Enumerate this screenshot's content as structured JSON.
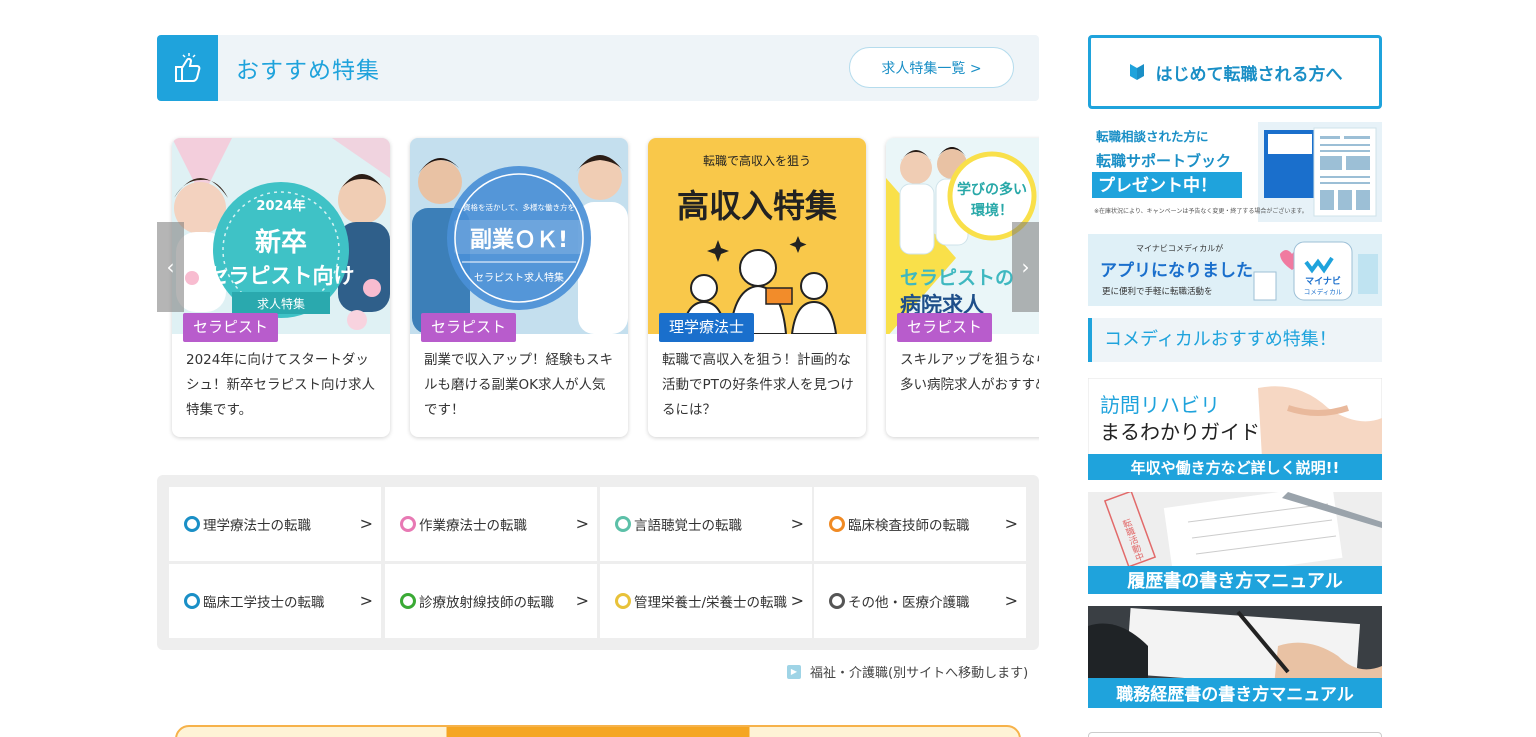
{
  "section": {
    "title": "おすすめ特集",
    "list_button": "求人特集一覧 >"
  },
  "cards": [
    {
      "image_title_lines": [
        "2024年",
        "新卒",
        "セラピスト向け",
        "求人特集"
      ],
      "tag": "セラピスト",
      "tag_color": "#b85ccc",
      "text": "2024年に向けてスタートダッシュ！新卒セラピスト向け求人特集です。"
    },
    {
      "image_title_lines": [
        "資格を活かして、多様な働き方を",
        "副業ＯＫ!",
        "セラピスト求人特集"
      ],
      "tag": "セラピスト",
      "tag_color": "#b85ccc",
      "text": "副業で収入アップ！経験もスキルも磨ける副業OK求人が人気です！"
    },
    {
      "image_title_lines": [
        "転職で高収入を狙う",
        "高収入特集"
      ],
      "tag": "理学療法士",
      "tag_color": "#1a6fcc",
      "text": "転職で高収入を狙う！計画的な活動でPTの好条件求人を見つけるには？"
    },
    {
      "image_title_lines": [
        "学びの多い",
        "環境！",
        "セラピストの",
        "病院求人"
      ],
      "tag": "セラピスト",
      "tag_color": "#b85ccc",
      "text": "スキルアップを狙うなら学びの多い病院求人がおすすめです！"
    }
  ],
  "carousel": {
    "prev": "‹",
    "next": "›"
  },
  "jobs": [
    {
      "label": "理学療法士の転職",
      "color": "#1a8fc6"
    },
    {
      "label": "作業療法士の転職",
      "color": "#e879b4"
    },
    {
      "label": "言語聴覚士の転職",
      "color": "#5cc0a8"
    },
    {
      "label": "臨床検査技師の転職",
      "color": "#f08a24"
    },
    {
      "label": "臨床工学技士の転職",
      "color": "#1a8fc6"
    },
    {
      "label": "診療放射線技師の転職",
      "color": "#3aaa35"
    },
    {
      "label": "管理栄養士/栄養士の転職",
      "color": "#e8c23a"
    },
    {
      "label": "その他・医療介護職",
      "color": "#555555"
    }
  ],
  "external_link": "福祉・介護職(別サイトへ移動します)",
  "sidebar": {
    "first_time": "はじめて転職される方へ",
    "book": {
      "line1": "転職相談された方に",
      "line2": "転職サポートブック",
      "line3": "プレゼント中！",
      "note": "※在庫状況により、キャンペーンは予告なく変更・終了する場合がございます。"
    },
    "app": {
      "line1": "マイナビコメディカルが",
      "line2": "アプリになりました",
      "line3": "更に便利で手軽に転職活動を",
      "logo1": "マイナビ",
      "logo2": "コメディカル"
    },
    "recommend_heading": "コメディカルおすすめ特集！",
    "visit": {
      "line1": "訪問リハビリ",
      "line2": "まるわかりガイド",
      "bar": "年収や働き方など詳しく説明!!"
    },
    "resume": {
      "bar": "履歴書の書き方マニュアル",
      "stamp": "転職活動中"
    },
    "cv": {
      "bar": "職務経歴書の書き方マニュアル"
    }
  },
  "colors": {
    "accent": "#1fa3dc",
    "accent_dark": "#1a8fc6",
    "section_bg": "#eef4f8"
  }
}
